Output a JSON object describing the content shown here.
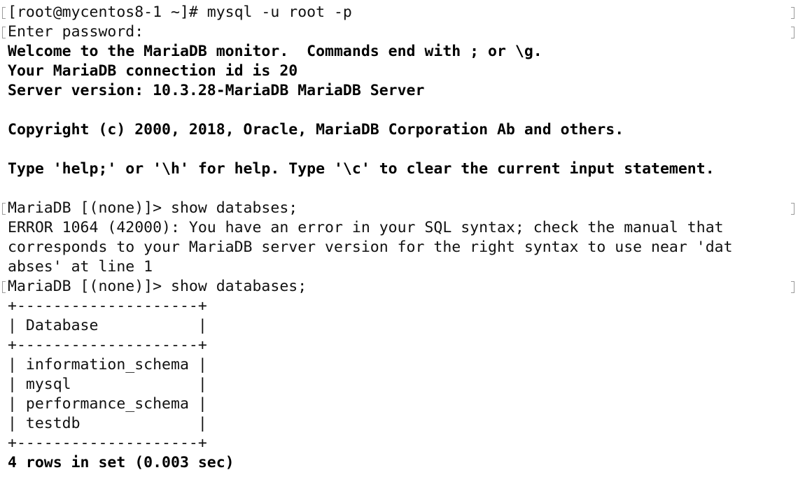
{
  "terminal": {
    "lines": [
      {
        "text": "[root@mycentos8-1 ~]# mysql -u root -p",
        "bold": false
      },
      {
        "text": "Enter password:",
        "bold": false
      },
      {
        "text": "Welcome to the MariaDB monitor.  Commands end with ; or \\g.",
        "bold": true
      },
      {
        "text": "Your MariaDB connection id is 20",
        "bold": true
      },
      {
        "text": "Server version: 10.3.28-MariaDB MariaDB Server",
        "bold": true
      },
      {
        "text": "",
        "bold": false
      },
      {
        "text": "Copyright (c) 2000, 2018, Oracle, MariaDB Corporation Ab and others.",
        "bold": true
      },
      {
        "text": "",
        "bold": false
      },
      {
        "text": "Type 'help;' or '\\h' for help. Type '\\c' to clear the current input statement.",
        "bold": true
      },
      {
        "text": "",
        "bold": false
      },
      {
        "text": "MariaDB [(none)]> show databses;",
        "bold": false
      },
      {
        "text": "ERROR 1064 (42000): You have an error in your SQL syntax; check the manual that",
        "bold": false
      },
      {
        "text": "corresponds to your MariaDB server version for the right syntax to use near 'dat",
        "bold": false
      },
      {
        "text": "abses' at line 1",
        "bold": false
      },
      {
        "text": "MariaDB [(none)]> show databases;",
        "bold": false
      },
      {
        "text": "+--------------------+",
        "bold": false
      },
      {
        "text": "| Database           |",
        "bold": false
      },
      {
        "text": "+--------------------+",
        "bold": false
      },
      {
        "text": "| information_schema |",
        "bold": false
      },
      {
        "text": "| mysql              |",
        "bold": false
      },
      {
        "text": "| performance_schema |",
        "bold": false
      },
      {
        "text": "| testdb             |",
        "bold": false
      },
      {
        "text": "+--------------------+",
        "bold": false
      },
      {
        "text": "4 rows in set (0.003 sec)",
        "bold": true
      }
    ]
  }
}
